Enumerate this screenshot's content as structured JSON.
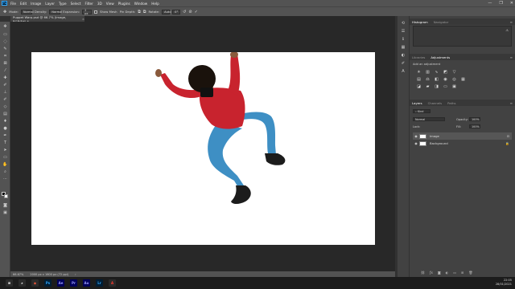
{
  "menubar": {
    "logo": "Ps",
    "items": [
      "File",
      "Edit",
      "Image",
      "Layer",
      "Type",
      "Select",
      "Filter",
      "3D",
      "View",
      "Plugins",
      "Window",
      "Help"
    ],
    "controls": [
      "—",
      "❐",
      "✕"
    ]
  },
  "options": {
    "mode_label": "Mode:",
    "mode_value": "Normal",
    "density_label": "Density:",
    "density_value": "Normal",
    "expansion_label": "Expansion:",
    "expansion_value": "2 px",
    "show_mesh_label": "Show Mesh",
    "pin_depth_label": "Pin Depth:",
    "rotate_label": "Rotate:",
    "rotate_value": "Auto",
    "rotate_angle": "0°"
  },
  "document": {
    "tab_title": "Puppet Warp.psd @ 66.7% (Image, RGB/8#) *",
    "zoom": "66.67%",
    "dimensions": "2000 px x 1600 px (72 ppi)"
  },
  "panels": {
    "histogram_tab": "Histogram",
    "navigator_tab": "Navigator",
    "libraries_tab": "Libraries",
    "adjustments_tab": "Adjustments",
    "add_adjustment": "Add an adjustment",
    "layers_tab": "Layers",
    "channels_tab": "Channels",
    "paths_tab": "Paths",
    "blend_mode": "Normal",
    "opacity_label": "Opacity:",
    "opacity_value": "100%",
    "lock_label": "Lock:",
    "fill_label": "Fill:",
    "fill_value": "100%",
    "layers": [
      {
        "name": "Image"
      },
      {
        "name": "Background"
      }
    ]
  },
  "taskbar": {
    "apps": [
      {
        "label": "⊞",
        "color": "#2b2b2b",
        "text_color": "#ffffff"
      },
      {
        "label": "⌕",
        "color": "#2b2b2b",
        "text_color": "#ffffff"
      },
      {
        "label": "◉",
        "color": "#2b2b2b",
        "text_color": "#ff5a3c"
      },
      {
        "label": "Ps",
        "color": "#001e36",
        "text_color": "#31a8ff"
      },
      {
        "label": "Ae",
        "color": "#00005b",
        "text_color": "#9999ff"
      },
      {
        "label": "Pr",
        "color": "#00005b",
        "text_color": "#9999ff"
      },
      {
        "label": "Au",
        "color": "#00005b",
        "text_color": "#9999ff"
      },
      {
        "label": "Lr",
        "color": "#001e36",
        "text_color": "#31a8ff"
      },
      {
        "label": "A",
        "color": "#2b2b2b",
        "text_color": "#ff3b2f"
      }
    ],
    "time": "22:05",
    "date": "28/01/2021"
  },
  "colors": {
    "shirt": "#c8232e",
    "jeans": "#3e8fc4",
    "skin": "#8a5a3c",
    "hair": "#1a120c",
    "shoe": "#1c1c1c"
  }
}
